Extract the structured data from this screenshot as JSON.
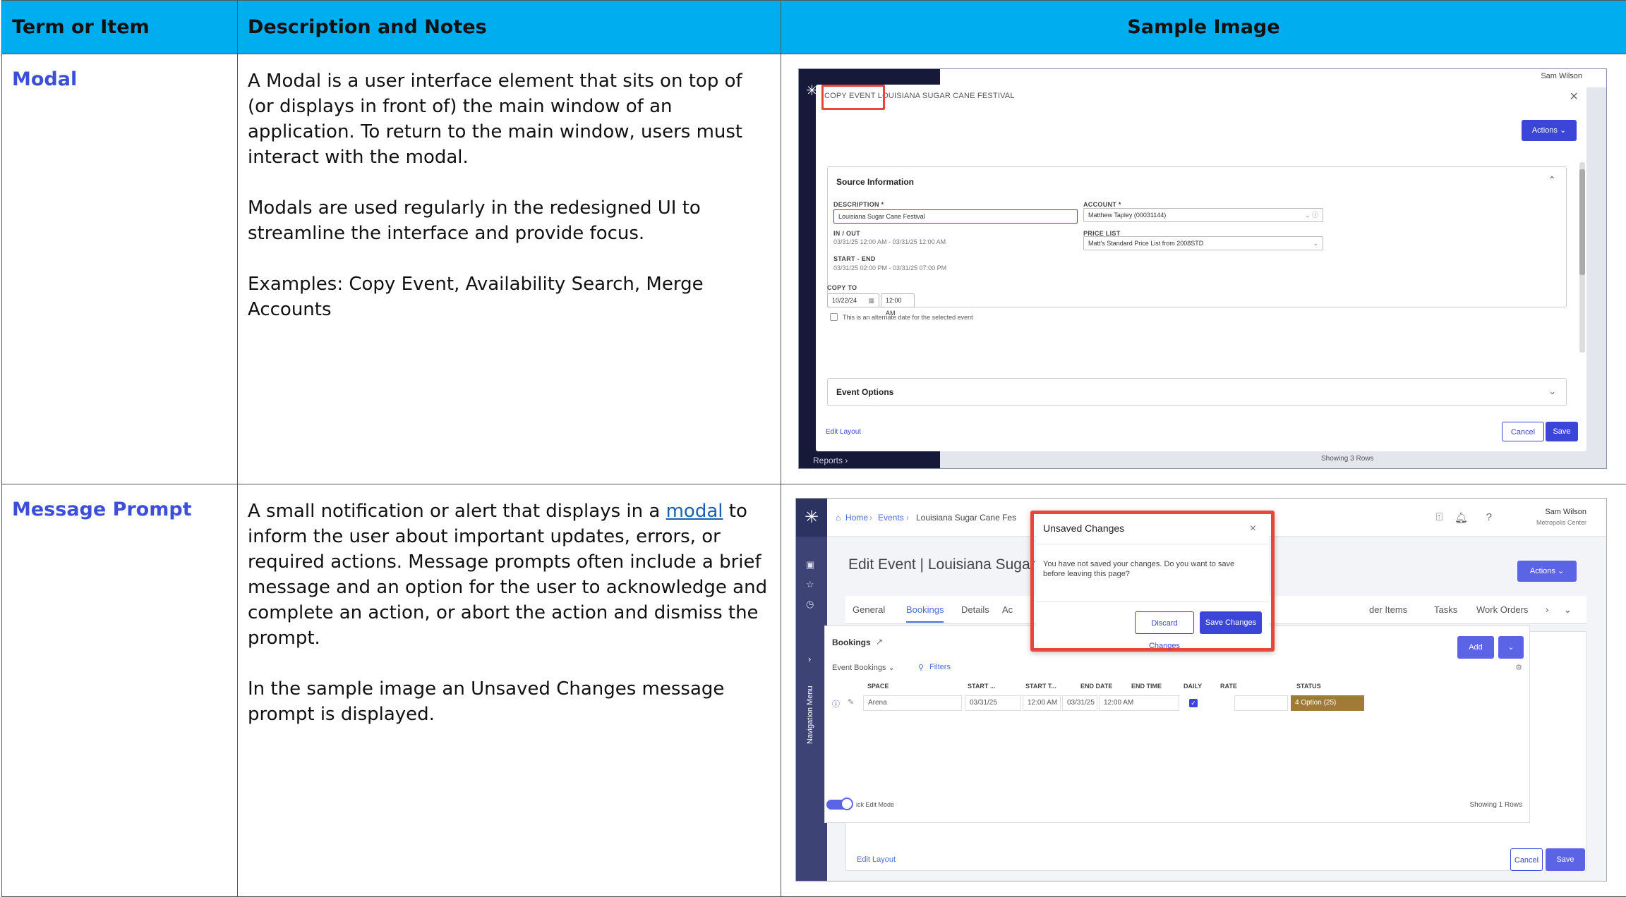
{
  "headers": [
    "Term or Item",
    "Description and Notes",
    "Sample Image"
  ],
  "rows": [
    {
      "term": "Modal",
      "paragraphs": [
        "A Modal is a user interface element that sits on top of (or displays in front of) the main window of an application. To return to the main window, users must interact with the modal.",
        "Modals are used regularly in the redesigned UI to streamline the interface and provide focus.",
        "Examples: Copy Event, Availability Search, Merge Accounts"
      ]
    },
    {
      "term": "Message Prompt",
      "p1_before": "A small notification or alert that displays in a ",
      "p1_link": "modal",
      "p1_after": " to inform the user about important updates, errors, or required actions. Message prompts often include a brief message and an option for the user to acknowledge and complete an action, or abort the action and dismiss the prompt.",
      "p2": "In the sample image an Unsaved Changes message prompt is displayed."
    }
  ],
  "sample1": {
    "title_highlight": "COPY EVENT",
    "title_rest": "LOUISIANA SUGAR CANE FESTIVAL",
    "close": "×",
    "actions": "Actions ⌄",
    "bg_user": "Sam Wilson",
    "section": "Source Information",
    "description_label": "DESCRIPTION *",
    "description_value": "Louisiana Sugar Cane Festival",
    "account_label": "ACCOUNT *",
    "account_value": "Matthew Tapley (00031144)",
    "inout_label": "IN / OUT",
    "inout_value": "03/31/25 12:00 AM - 03/31/25 12:00 AM",
    "pricelist_label": "PRICE LIST",
    "pricelist_value": "Matt's Standard Price List from 2008STD",
    "startend_label": "START - END",
    "startend_value": "03/31/25 02:00 PM - 03/31/25 07:00 PM",
    "copyto_label": "COPY TO",
    "copyto_date": "10/22/24",
    "copyto_time": "12:00 AM",
    "alt_date": "This is an alternate date for the selected event",
    "event_options": "Event Options",
    "edit_layout": "Edit Layout",
    "cancel": "Cancel",
    "save": "Save",
    "reports": "Reports ›",
    "showing": "Showing 3 Rows"
  },
  "sample2": {
    "crumb_home": "Home",
    "crumb_events": "Events",
    "crumb_event": "Louisiana Sugar Cane Fes",
    "user_name": "Sam Wilson",
    "user_org": "Metropolis Center",
    "title": "Edit Event | Louisiana Sugar",
    "actions": "Actions ⌄",
    "tabs": [
      "General",
      "Bookings",
      "Details",
      "Ac",
      "der Items",
      "Tasks",
      "Work Orders"
    ],
    "bookings": "Bookings",
    "add": "Add",
    "event_bookings": "Event Bookings ⌄",
    "filters": "Filters",
    "columns": [
      "SPACE",
      "START ...",
      "START T...",
      "END DATE",
      "END TIME",
      "DAILY",
      "RATE",
      "STATUS"
    ],
    "row": {
      "space": "Arena",
      "start_date": "03/31/25",
      "start_time": "12:00 AM",
      "end_date": "03/31/25",
      "end_time": "12:00 AM",
      "status": "4 Option (25)"
    },
    "quick_edit": "ick Edit Mode",
    "showing": "Showing 1 Rows",
    "edit_layout": "Edit Layout",
    "cancel": "Cancel",
    "save": "Save",
    "nav_menu": "Navigation Menu",
    "prompt_title": "Unsaved Changes",
    "prompt_close": "×",
    "prompt_message": "You have not saved your changes. Do you want to save before leaving this page?",
    "discard": "Discard Changes",
    "save_changes": "Save Changes"
  }
}
